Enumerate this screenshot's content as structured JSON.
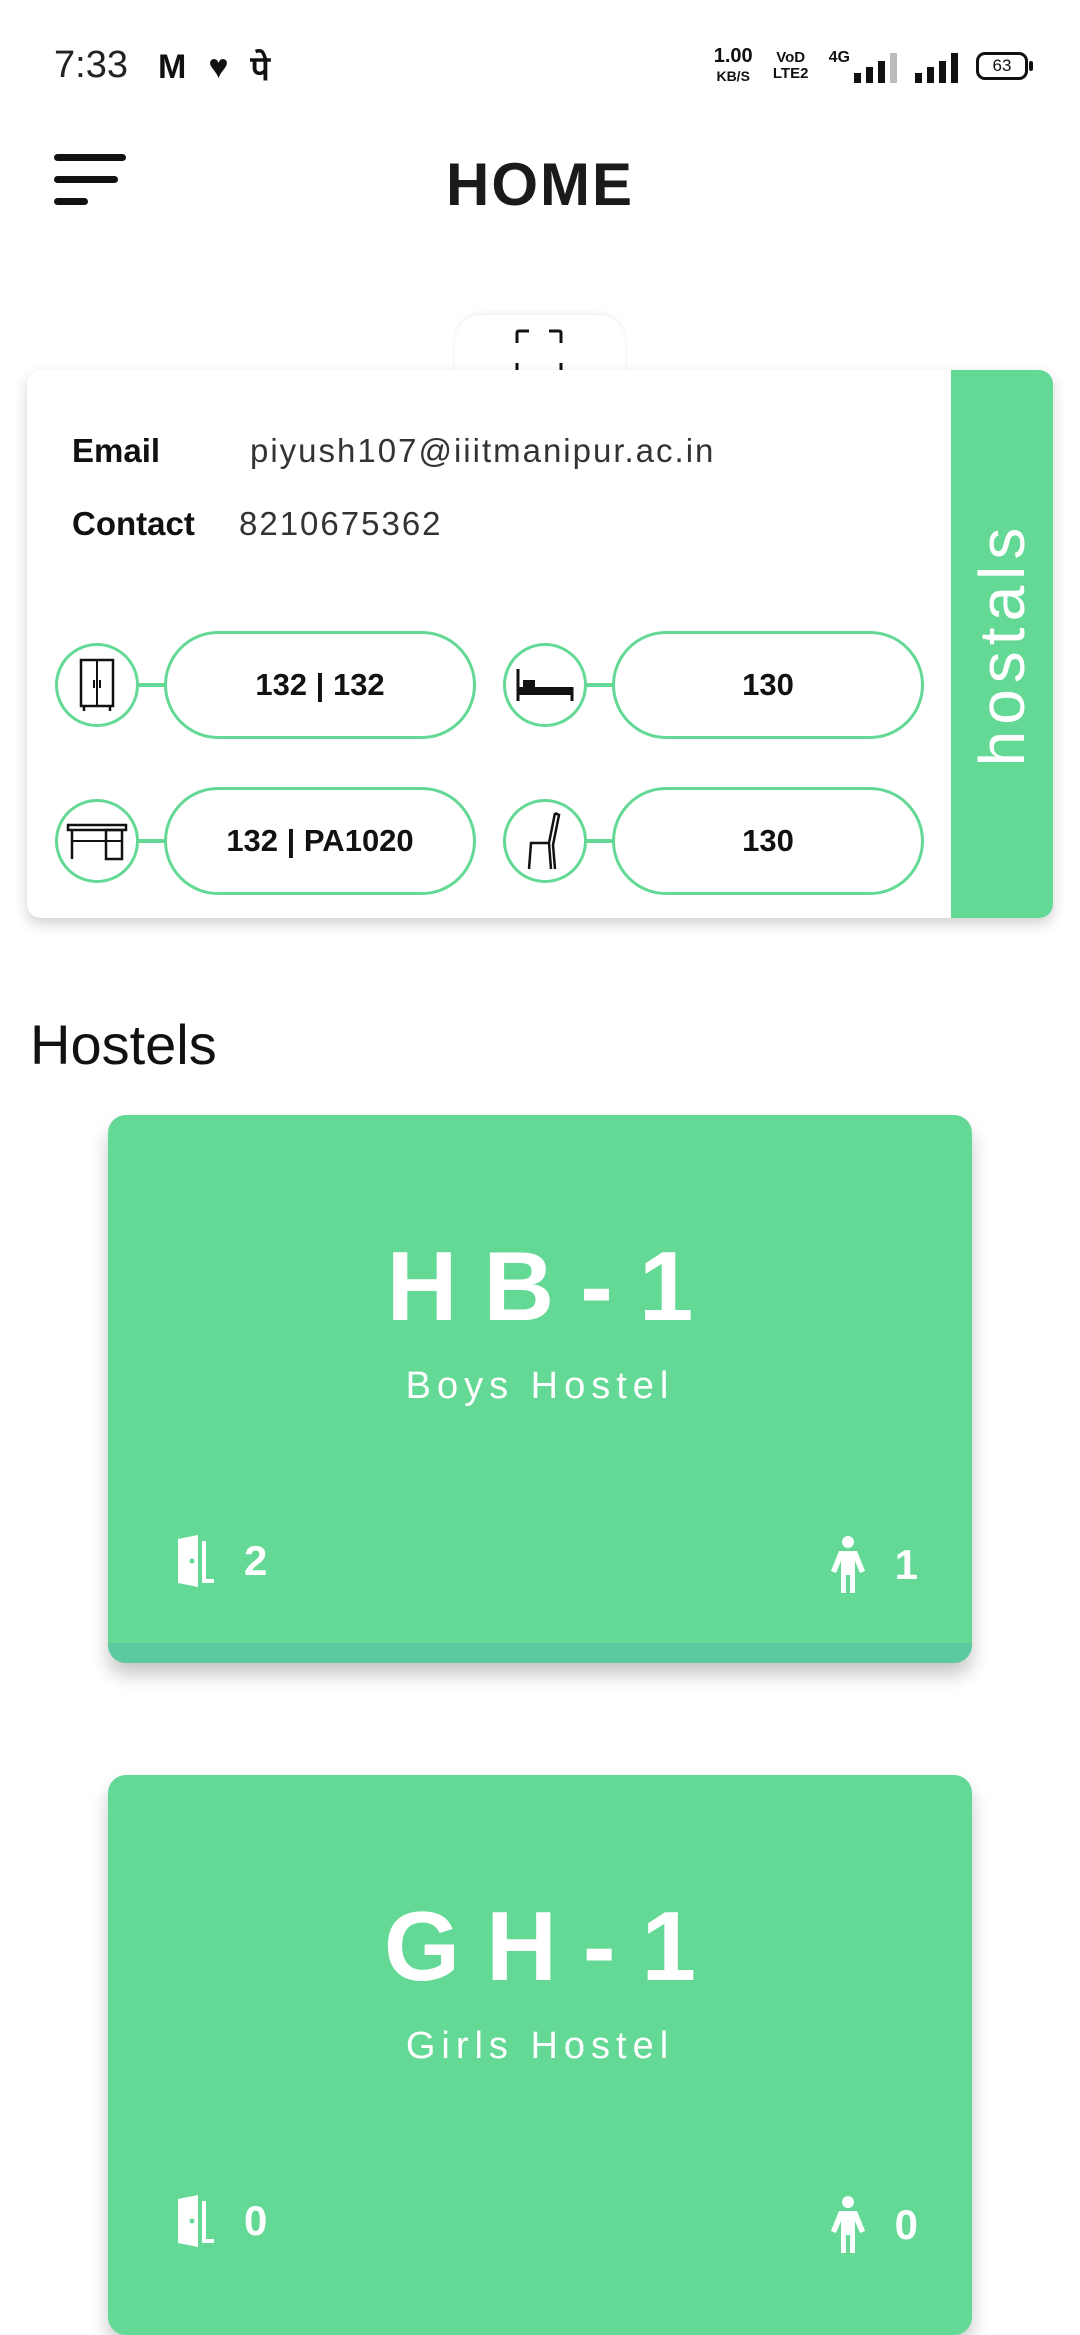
{
  "status_bar": {
    "time": "7:33",
    "app_icons": [
      "M",
      "♥",
      "पे"
    ],
    "net_speed": "1.00",
    "net_unit": "KB/S",
    "volte": "VoD LTE2",
    "network": "4G",
    "battery": "63"
  },
  "header": {
    "title": "HOME",
    "menu_icon": "hamburger-menu-icon"
  },
  "profile": {
    "email_label": "Email",
    "email_value": "piyush107@iiitmanipur.ac.in",
    "contact_label": "Contact",
    "contact_value": "8210675362",
    "side_tab": "hostals",
    "assets": [
      {
        "icon": "wardrobe-icon",
        "value": "132 | 132"
      },
      {
        "icon": "bed-icon",
        "value": "130"
      },
      {
        "icon": "desk-icon",
        "value": "132 | PA1020"
      },
      {
        "icon": "chair-icon",
        "value": "130"
      }
    ]
  },
  "hostels_section": {
    "title": "Hostels"
  },
  "hostels": [
    {
      "code": "HB-1",
      "type": "Boys Hostel",
      "rooms": "2",
      "residents": "1"
    },
    {
      "code": "GH-1",
      "type": "Girls Hostel",
      "rooms": "0",
      "residents": "0"
    }
  ],
  "colors": {
    "accent": "#64d995",
    "accent_dark": "#5cc99e",
    "text": "#111111"
  }
}
